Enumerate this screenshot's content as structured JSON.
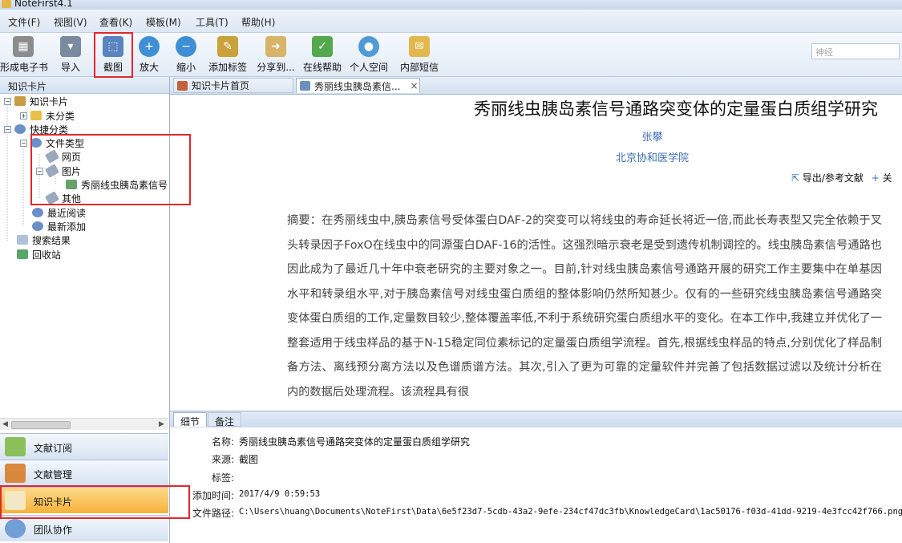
{
  "window": {
    "title": "NoteFirst4.1"
  },
  "menu": [
    "文件(F)",
    "视图(V)",
    "查看(K)",
    "模板(M)",
    "工具(T)",
    "帮助(H)"
  ],
  "toolbar": {
    "buttons": [
      "形成电子书",
      "导入",
      "截图",
      "放大",
      "缩小",
      "添加标签",
      "分享到...",
      "在线帮助",
      "个人空间",
      "内部短信"
    ],
    "search_placeholder": "神经"
  },
  "left_panel": {
    "header": "知识卡片",
    "tree": [
      "知识卡片",
      "未分类",
      "快捷分类",
      "文件类型",
      "网页",
      "图片",
      "秀丽线虫胰岛素信号",
      "其他",
      "最近阅读",
      "最新添加",
      "搜索结果",
      "回收站"
    ],
    "nav": [
      "文献订阅",
      "文献管理",
      "知识卡片",
      "团队协作"
    ],
    "active_nav": "知识卡片"
  },
  "tabs": [
    "知识卡片首页",
    "秀丽线虫胰岛素信..."
  ],
  "article": {
    "title": "秀丽线虫胰岛素信号通路突变体的定量蛋白质组学研究",
    "author": "张攀",
    "affiliation": "北京协和医学院",
    "actions": [
      "导出/参考文献",
      "关"
    ],
    "abstract": "摘要：在秀丽线虫中,胰岛素信号受体蛋白DAF-2的突变可以将线虫的寿命延长将近一倍,而此长寿表型又完全依赖于叉头转录因子FoxO在线虫中的同源蛋白DAF-16的活性。这强烈暗示衰老是受到遗传机制调控的。线虫胰岛素信号通路也因此成为了最近几十年中衰老研究的主要对象之一。目前,针对线虫胰岛素信号通路开展的研究工作主要集中在单基因水平和转录组水平,对于胰岛素信号对线虫蛋白质组的整体影响仍然所知甚少。仅有的一些研究线虫胰岛素信号通路突变体蛋白质组的工作,定量数目较少,整体覆盖率低,不利于系统研究蛋白质组水平的变化。在本工作中,我建立并优化了一整套适用于线虫样品的基于N-15稳定同位素标记的定量蛋白质组学流程。首先,根据线虫样品的特点,分别优化了样品制备方法、离线预分离方法以及色谱质谱方法。其次,引入了更为可靠的定量软件并完善了包括数据过滤以及统计分析在内的数据后处理流程。该流程具有很"
  },
  "detail": {
    "tabs": [
      "细节",
      "备注"
    ],
    "fields": [
      {
        "label": "名称:",
        "value": "秀丽线虫胰岛素信号通路突变体的定量蛋白质组学研究"
      },
      {
        "label": "来源:",
        "value": "截图"
      },
      {
        "label": "标签:",
        "value": ""
      },
      {
        "label": "添加时间:",
        "value": "2017/4/9 0:59:53"
      },
      {
        "label": "文件路径:",
        "value": "C:\\Users\\huang\\Documents\\NoteFirst\\Data\\6e5f23d7-5cdb-43a2-9efe-234cf47dc3fb\\KnowledgeCard\\1ac50176-f03d-41dd-9219-4e3fcc42f766.png"
      }
    ]
  },
  "colors": {
    "highlight": "#e0282e",
    "link": "#3d6fb3",
    "active_nav": "#f5b23a"
  }
}
